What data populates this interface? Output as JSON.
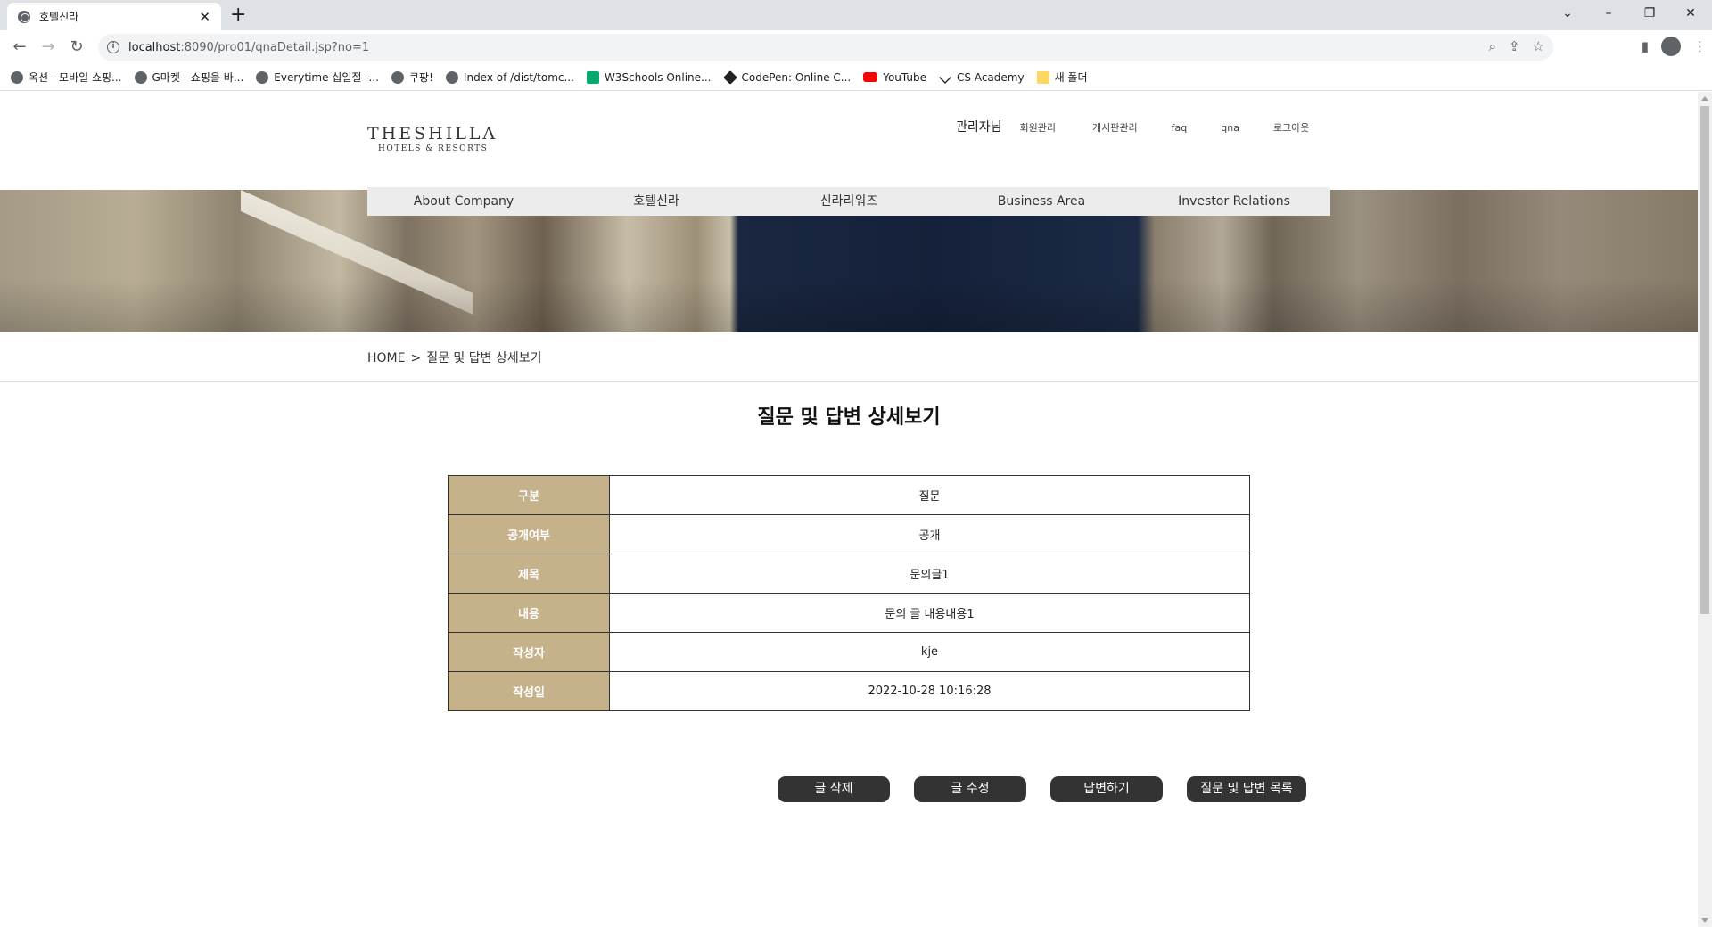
{
  "browser": {
    "tab_title": "호텔신라",
    "url_host": "localhost",
    "url_rest": ":8090/pro01/qnaDetail.jsp?no=1",
    "bookmarks": [
      {
        "label": "옥션 - 모바일 쇼핑...",
        "icon": "globe-icon"
      },
      {
        "label": "G마켓 - 쇼핑을 바...",
        "icon": "globe-icon"
      },
      {
        "label": "Everytime 십일절 -...",
        "icon": "globe-icon"
      },
      {
        "label": "쿠팡!",
        "icon": "globe-icon"
      },
      {
        "label": "Index of /dist/tomc...",
        "icon": "globe-icon"
      },
      {
        "label": "W3Schools Online...",
        "icon": "w3schools-icon"
      },
      {
        "label": "CodePen: Online C...",
        "icon": "codepen-icon"
      },
      {
        "label": "YouTube",
        "icon": "youtube-icon"
      },
      {
        "label": "CS Academy",
        "icon": "cs-academy-icon"
      },
      {
        "label": "새 폴더",
        "icon": "folder-icon"
      }
    ]
  },
  "header": {
    "logo_line1": "THESHILLA",
    "logo_line2": "HOTELS & RESORTS",
    "admin_label": "관리자님",
    "util_links": [
      "회원관리",
      "게시판관리",
      "faq",
      "qna",
      "로그아웃"
    ]
  },
  "gnb": {
    "items": [
      "About Company",
      "호텔신라",
      "신라리워즈",
      "Business Area",
      "Investor Relations"
    ]
  },
  "breadcrumb": {
    "home": "HOME",
    "separator": ">",
    "current": "질문 및 답변 상세보기"
  },
  "page_title": "질문 및 답변 상세보기",
  "detail": {
    "rows": [
      {
        "label": "구분",
        "value": "질문"
      },
      {
        "label": "공개여부",
        "value": "공개"
      },
      {
        "label": "제목",
        "value": "문의글1"
      },
      {
        "label": "내용",
        "value": "문의 글 내용내용1"
      },
      {
        "label": "작성자",
        "value": "kje"
      },
      {
        "label": "작성일",
        "value": "2022-10-28 10:16:28"
      }
    ]
  },
  "actions": {
    "delete": "글 삭제",
    "edit": "글 수정",
    "reply": "답변하기",
    "list": "질문 및 답변 목록"
  },
  "colors": {
    "table_header": "#c5b28b",
    "button_bg": "#333333",
    "nav_bg": "#ececec"
  }
}
